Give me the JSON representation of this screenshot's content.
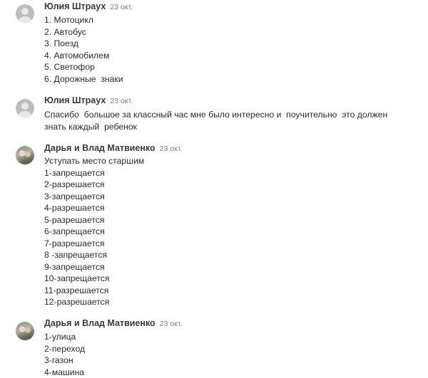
{
  "comments": [
    {
      "author": "Юлия Штраух",
      "date": "23 окт.",
      "lines": [
        "1. Мотоцикл",
        "2. Автобус",
        "3. Поезд",
        "4. Автомобилем",
        "5. Светофор",
        "6. Дорожные  знаки"
      ]
    },
    {
      "author": "Юлия Штраух",
      "date": "23 окт.",
      "text": "Спасибо  большое за классный час мне было интересно и  поучительно  это должен знать каждый  ребенок"
    },
    {
      "author": "Дарья и Влад Матвиенко",
      "date": "23 окт.",
      "lines": [
        "Уступать место старшим",
        "1-запрещается",
        "2-разрешается",
        "3-запрещается",
        "4-разрешается",
        "5-разрешается",
        "6-запрещается",
        "7-разрешается",
        "8 -запрещается",
        "9-запрещается",
        "10-запрещается",
        "11-разрешается",
        "12-разрешается"
      ]
    },
    {
      "author": "Дарья и Влад Матвиенко",
      "date": "23 окт.",
      "lines": [
        "1-улица",
        "2-переход",
        "3-газон",
        "4-машина"
      ]
    }
  ]
}
